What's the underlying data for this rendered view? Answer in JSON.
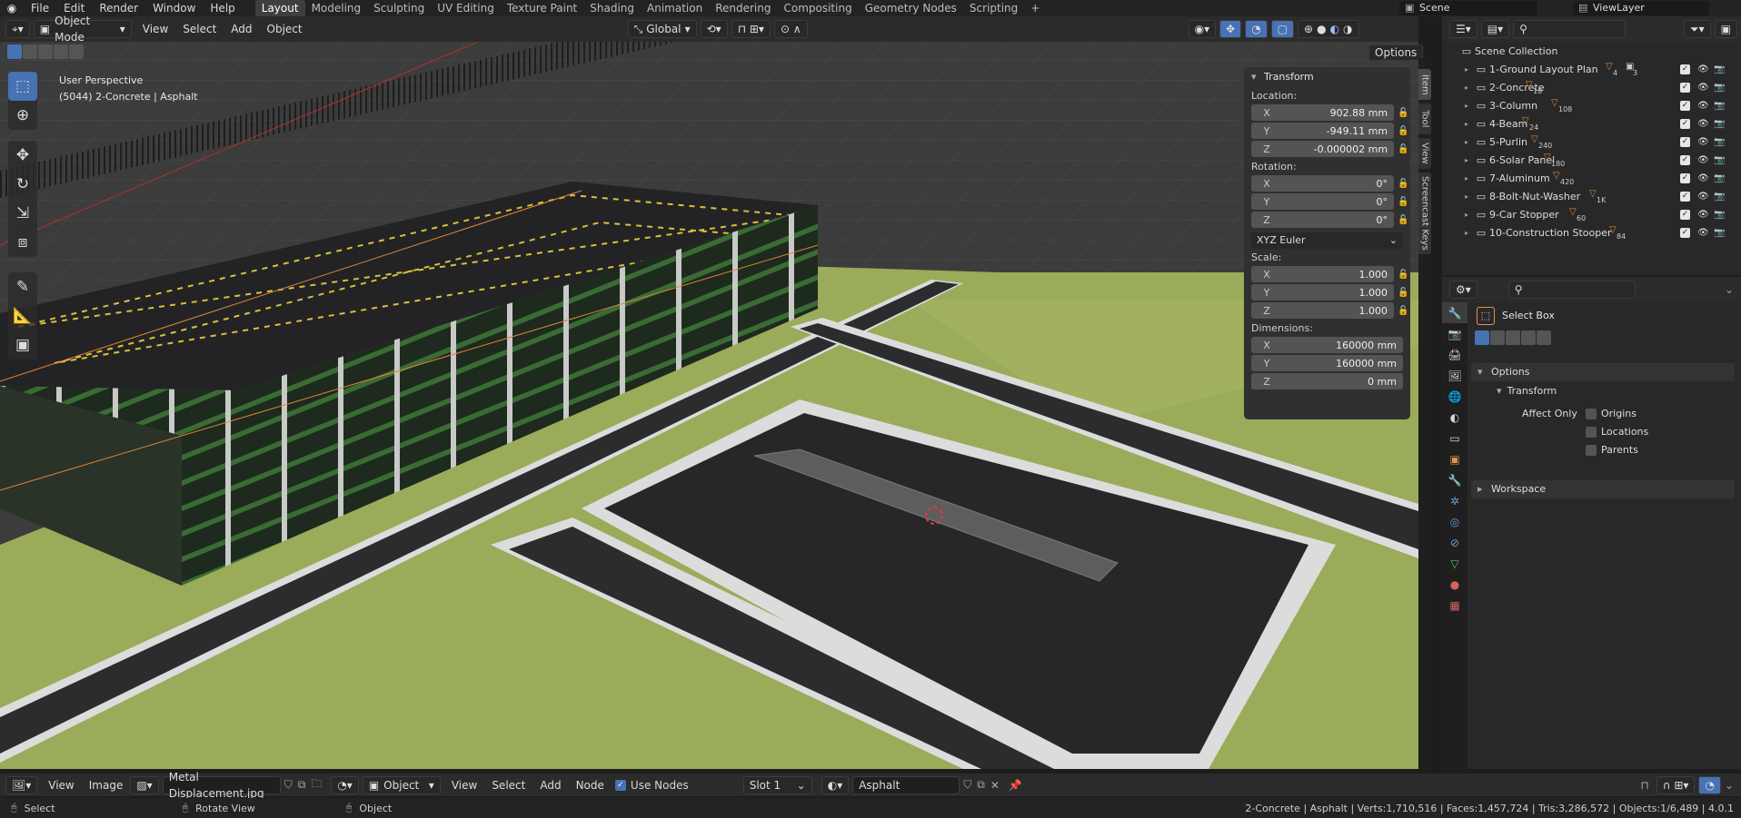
{
  "menu": {
    "items": [
      "File",
      "Edit",
      "Render",
      "Window",
      "Help"
    ]
  },
  "workspaces": {
    "tabs": [
      "Layout",
      "Modeling",
      "Sculpting",
      "UV Editing",
      "Texture Paint",
      "Shading",
      "Animation",
      "Rendering",
      "Compositing",
      "Geometry Nodes",
      "Scripting"
    ],
    "active": "Layout",
    "add_label": "+"
  },
  "scene": {
    "name": "Scene",
    "view_layer": "ViewLayer"
  },
  "viewport_header": {
    "mode": "Object Mode",
    "menus": [
      "View",
      "Select",
      "Add",
      "Object"
    ],
    "orientation": "Global",
    "options_label": "Options"
  },
  "viewport": {
    "perspective": "User Perspective",
    "object_info": "(5044) 2-Concrete | Asphalt"
  },
  "npanel": {
    "title": "Transform",
    "location_label": "Location:",
    "location": [
      {
        "axis": "X",
        "value": "902.88 mm"
      },
      {
        "axis": "Y",
        "value": "-949.11 mm"
      },
      {
        "axis": "Z",
        "value": "-0.000002 mm"
      }
    ],
    "rotation_label": "Rotation:",
    "rotation": [
      {
        "axis": "X",
        "value": "0°"
      },
      {
        "axis": "Y",
        "value": "0°"
      },
      {
        "axis": "Z",
        "value": "0°"
      }
    ],
    "rotation_mode": "XYZ Euler",
    "scale_label": "Scale:",
    "scale": [
      {
        "axis": "X",
        "value": "1.000"
      },
      {
        "axis": "Y",
        "value": "1.000"
      },
      {
        "axis": "Z",
        "value": "1.000"
      }
    ],
    "dimensions_label": "Dimensions:",
    "dimensions": [
      {
        "axis": "X",
        "value": "160000 mm"
      },
      {
        "axis": "Y",
        "value": "160000 mm"
      },
      {
        "axis": "Z",
        "value": "0 mm"
      }
    ],
    "side_tabs": [
      "Item",
      "Tool",
      "View",
      "Screencast Keys"
    ]
  },
  "outliner": {
    "root": "Scene Collection",
    "collections": [
      {
        "name": "1-Ground Layout Plan",
        "count": "4",
        "count2": "3"
      },
      {
        "name": "2-Concrete",
        "count": "18"
      },
      {
        "name": "3-Column",
        "count": "108"
      },
      {
        "name": "4-Beam",
        "count": "24"
      },
      {
        "name": "5-Purlin",
        "count": "240"
      },
      {
        "name": "6-Solar Panel",
        "count": "180"
      },
      {
        "name": "7-Aluminum",
        "count": "420"
      },
      {
        "name": "8-Bolt-Nut-Washer",
        "count": "1K"
      },
      {
        "name": "9-Car Stopper",
        "count": "60"
      },
      {
        "name": "10-Construction Stooper",
        "count": "84"
      }
    ]
  },
  "properties": {
    "tool_name": "Select Box",
    "options_label": "Options",
    "transform_label": "Transform",
    "affect_only_label": "Affect Only",
    "affect": [
      "Origins",
      "Locations",
      "Parents"
    ],
    "workspace_label": "Workspace"
  },
  "bottom_header": {
    "menus_left": [
      "View",
      "Image"
    ],
    "image_name": "Metal Displacement.jpg",
    "object_label": "Object",
    "menus_mid": [
      "View",
      "Select",
      "Add",
      "Node"
    ],
    "use_nodes_label": "Use Nodes",
    "slot": "Slot 1",
    "material": "Asphalt"
  },
  "statusbar": {
    "hint_select": "Select",
    "hint_rotate": "Rotate View",
    "hint_object": "Object",
    "stats": "2-Concrete | Asphalt | Verts:1,710,516 | Faces:1,457,724 | Tris:3,286,572 | Objects:1/6,489 | 4.0.1"
  },
  "colors": {
    "accent": "#4772b3",
    "grass": "#9aab5a",
    "road": "#2a2c2e",
    "header": "#2b2b2b"
  }
}
